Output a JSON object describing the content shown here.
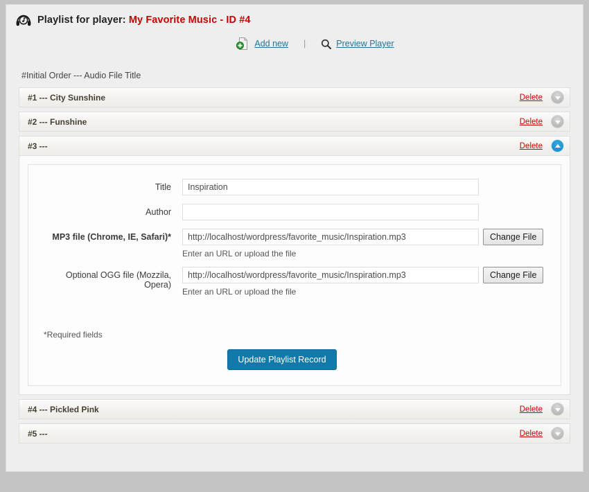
{
  "panel": {
    "title_prefix": "Playlist for player: ",
    "title_accent": "My Favorite Music - ID #4",
    "header_icon": "headphones-music-icon"
  },
  "toolbar": {
    "add_new_label": "Add new",
    "add_new_icon": "add-circle-page-icon",
    "separator": "|",
    "preview_label": "Preview Player",
    "preview_icon": "search-magnifier-icon"
  },
  "list": {
    "legend": "#Initial Order --- Audio File Title",
    "delete_label": "Delete",
    "rows": [
      {
        "label": "#1 --- City Sunshine",
        "expanded": false,
        "toggle_icon": "chevron-down-icon"
      },
      {
        "label": "#2 --- Funshine",
        "expanded": false,
        "toggle_icon": "chevron-down-icon"
      },
      {
        "label": "#3 ---",
        "expanded": true,
        "toggle_icon": "chevron-up-icon"
      },
      {
        "label": "#4 --- Pickled Pink",
        "expanded": false,
        "toggle_icon": "chevron-down-icon"
      },
      {
        "label": "#5 ---",
        "expanded": false,
        "toggle_icon": "chevron-down-icon"
      }
    ]
  },
  "form": {
    "title_label": "Title",
    "title_value": "Inspiration",
    "author_label": "Author",
    "author_value": "",
    "mp3_label": "MP3 file (Chrome, IE, Safari)*",
    "mp3_value": "http://localhost/wordpress/favorite_music/Inspiration.mp3",
    "mp3_hint": "Enter an URL or upload the file",
    "ogg_label": "Optional OGG file (Mozzila, Opera)",
    "ogg_value": "http://localhost/wordpress/favorite_music/Inspiration.mp3",
    "ogg_hint": "Enter an URL or upload the file",
    "change_file_label": "Change File",
    "required_note": "*Required fields",
    "submit_label": "Update Playlist Record"
  },
  "colors": {
    "accent_red": "#cc0000",
    "link_blue": "#21759b",
    "button_blue": "#1279ab",
    "toggle_active": "#1b93cf",
    "page_bg": "#c4c4c4",
    "panel_bg": "#eeeeee"
  }
}
